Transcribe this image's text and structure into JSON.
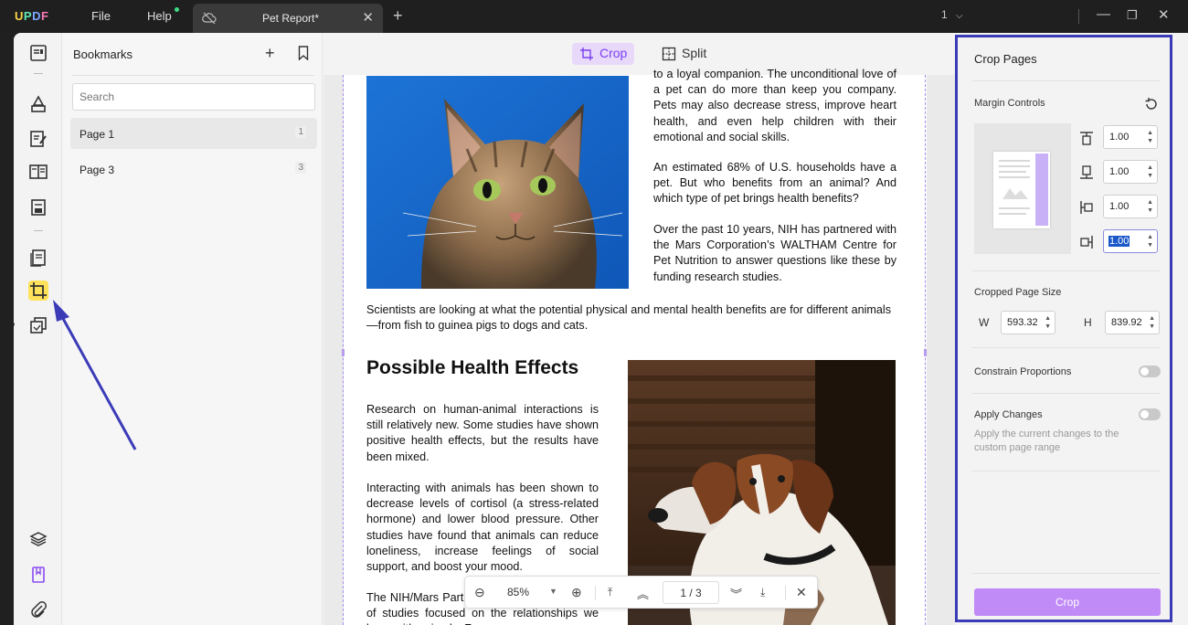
{
  "titlebar": {
    "logo": "UPDF",
    "menu": [
      "File",
      "Help"
    ],
    "tab_title": "Pet Report*",
    "page_selector": "1"
  },
  "bookmarks": {
    "title": "Bookmarks",
    "search_placeholder": "Search",
    "items": [
      {
        "label": "Page 1",
        "page": "1"
      },
      {
        "label": "Page 3",
        "page": "3"
      }
    ]
  },
  "modes": {
    "crop": "Crop",
    "split": "Split"
  },
  "document": {
    "para_top": "to a loyal companion. The unconditional love of a pet can do more than keep you company. Pets may also decrease stress, improve heart health, and even help children with their emotional and social skills.",
    "para_68": "An estimated 68% of U.S. households have a pet. But who benefits from an animal? And which type of pet brings health benefits?",
    "para_nih": "Over the past 10 years, NIH has partnered with the Mars Corporation’s WALTHAM Centre for Pet Nutrition to answer questions like these by funding research studies.",
    "para_scientists": "Scientists are looking at what the potential physical and mental health benefits are for different animals—from fish to guinea pigs to dogs and cats.",
    "heading": "Possible Health Effects",
    "para_research": "Research on human-animal interactions is still relatively new. Some studies have shown positive health effects, but the results have been mixed.",
    "para_interacting": "Interacting with animals has been shown to decrease levels of cortisol (a stress-related hormone) and lower blood pressure. Other studies have found that animals can reduce loneliness, increase feelings of social support, and boost your mood.",
    "para_nihmars": "The NIH/Mars Partnership is funding a range of studies focused on the relationships we have with animals. For"
  },
  "pagenav": {
    "zoom": "85%",
    "page_indicator": "1 / 3"
  },
  "crop_panel": {
    "title": "Crop Pages",
    "margin_controls": "Margin Controls",
    "margins": {
      "top": "1.00",
      "bottom": "1.00",
      "left": "1.00",
      "right": "1.00"
    },
    "cropped_size_label": "Cropped Page Size",
    "w_label": "W",
    "w_value": "593.32",
    "h_label": "H",
    "h_value": "839.92",
    "constrain": "Constrain Proportions",
    "constrain_on": false,
    "apply_changes": "Apply Changes",
    "apply_on": false,
    "apply_hint": "Apply the current changes to the custom page range",
    "crop_button": "Crop"
  },
  "colors": {
    "accent_purple": "#7b3ff2",
    "crop_button": "#c08bf7",
    "highlight_frame": "#3b3bb8",
    "active_tool": "#ffe15a"
  }
}
